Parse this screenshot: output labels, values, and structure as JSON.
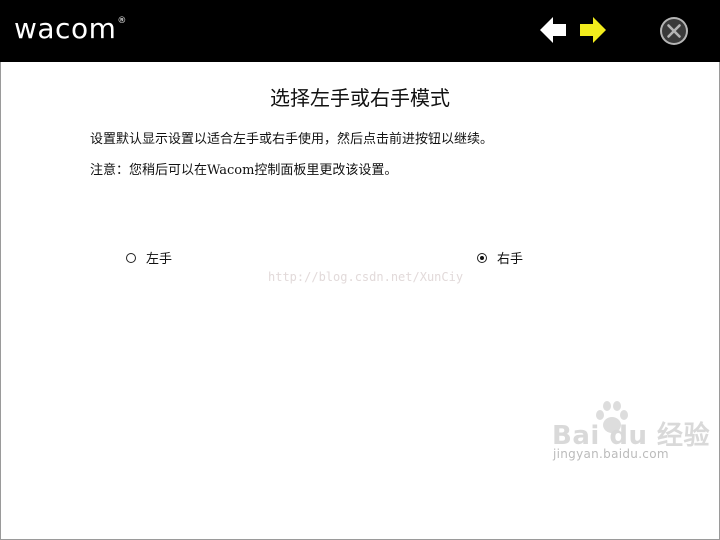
{
  "header": {
    "logo": "wacom",
    "trademark": "®",
    "back_icon": "arrow-left-icon",
    "next_icon": "arrow-right-icon",
    "close_icon": "close-icon"
  },
  "main": {
    "title": "选择左手或右手模式",
    "description": "设置默认显示设置以适合左手或右手使用，然后点击前进按钮以继续。",
    "note": "注意：您稍后可以在Wacom控制面板里更改该设置。",
    "options": [
      {
        "label": "左手",
        "selected": false
      },
      {
        "label": "右手",
        "selected": true
      }
    ]
  },
  "watermark": {
    "url": "http://blog.csdn.net/XunCiy",
    "brand": "Bai du 经验",
    "site": "jingyan.baidu.com"
  },
  "colors": {
    "topbar": "#000000",
    "back_arrow": "#ffffff",
    "next_arrow": "#f2ec1d",
    "close_circle": "#b5b5b5"
  }
}
